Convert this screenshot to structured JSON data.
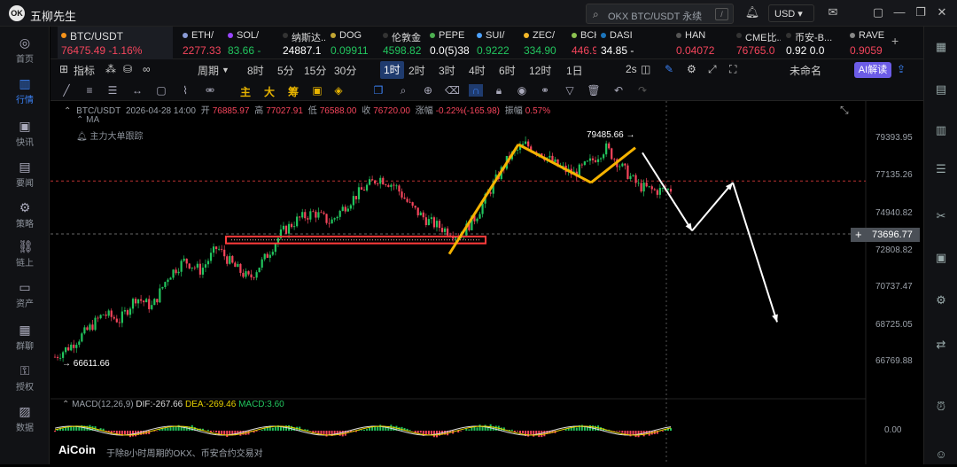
{
  "titlebar": {
    "app_title": "五柳先生",
    "logo": "OK",
    "search_placeholder": "OKX BTC/USDT 永续",
    "search_kbd": "/",
    "currency": "USD ▾"
  },
  "sidebar": {
    "items": [
      {
        "label": "首页",
        "icon": "home-icon",
        "glyph": "◎"
      },
      {
        "label": "行情",
        "icon": "chart-bars-icon",
        "glyph": "▥"
      },
      {
        "label": "快讯",
        "icon": "news-icon",
        "glyph": "▣"
      },
      {
        "label": "要闻",
        "icon": "document-icon",
        "glyph": "▤"
      },
      {
        "label": "策略",
        "icon": "strategy-icon",
        "glyph": "⚙"
      },
      {
        "label": "链上",
        "icon": "chain-icon",
        "glyph": "⛓"
      },
      {
        "label": "资产",
        "icon": "wallet-icon",
        "glyph": "▭"
      },
      {
        "label": "群聊",
        "icon": "chat-icon",
        "glyph": "▦"
      },
      {
        "label": "授权",
        "icon": "key-icon",
        "glyph": "⚿"
      },
      {
        "label": "数据",
        "icon": "data-icon",
        "glyph": "▨"
      }
    ]
  },
  "tickers": [
    {
      "name": "BTC/USDT",
      "price": "76475.49",
      "change": "-1.16%",
      "color": "#f5455c",
      "dot": "#f7931a"
    },
    {
      "name": "ETH/",
      "price": "2277.33",
      "change": "",
      "color": "#f5455c",
      "dot": "#8a9bd6"
    },
    {
      "name": "SOL/",
      "price": "83.66",
      "change": "-",
      "color": "#22c55e",
      "dot": "#9945ff"
    },
    {
      "name": "纳斯达...",
      "price": "24887.1",
      "change": "",
      "color": "#ffffff",
      "dot": "#333"
    },
    {
      "name": "DOG",
      "price": "0.09911",
      "change": "",
      "color": "#22c55e",
      "dot": "#c2a633"
    },
    {
      "name": "伦敦金",
      "price": "4598.82",
      "change": "",
      "color": "#22c55e",
      "dot": "#333"
    },
    {
      "name": "PEPE",
      "price": "0.0(5)38",
      "change": "",
      "color": "#ffffff",
      "dot": "#4caf50"
    },
    {
      "name": "SUI/",
      "price": "0.9222",
      "change": "",
      "color": "#22c55e",
      "dot": "#4da2ff"
    },
    {
      "name": "ZEC/",
      "price": "334.90",
      "change": "",
      "color": "#22c55e",
      "dot": "#f4b728"
    },
    {
      "name": "BCH",
      "price": "446.9",
      "change": "-",
      "color": "#f5455c",
      "dot": "#8dc351"
    },
    {
      "name": "DASI",
      "price": "34.85",
      "change": "-",
      "color": "#ffffff",
      "dot": "#1c75bc"
    },
    {
      "name": "HAN",
      "price": "0.04072",
      "change": "",
      "color": "#f5455c",
      "dot": "#555"
    },
    {
      "name": "CME比...",
      "price": "76765.0",
      "change": "",
      "color": "#f5455c",
      "dot": "#333"
    },
    {
      "name": "币安-B...",
      "price": "0.92",
      "change": "0.0",
      "color": "#ffffff",
      "dot": "#333"
    },
    {
      "name": "RAVE",
      "price": "0.9059",
      "change": "",
      "color": "#f5455c",
      "dot": "#888"
    }
  ],
  "toolbar": {
    "indicator": "指标",
    "period": "周期",
    "intervals": [
      "8时",
      "5分",
      "15分",
      "30分",
      "1时",
      "2时",
      "3时",
      "4时",
      "6时",
      "12时",
      "1日"
    ],
    "selected_interval": "1时",
    "secs": "2s",
    "unnamed": "未命名",
    "ai": "AI解读"
  },
  "drawtools": {
    "zhu": "主",
    "da": "大",
    "chou": "筹"
  },
  "info": {
    "symbol": "BTC/USDT",
    "datetime": "2026-04-28 14:00",
    "open_label": "开",
    "open": "76885.97",
    "high_label": "高",
    "high": "77027.91",
    "low_label": "低",
    "low": "76588.00",
    "close_label": "收",
    "close": "76720.00",
    "chg_label": "涨幅",
    "chg": "-0.22%(-165.98)",
    "amp_label": "振幅",
    "amp": "0.57%",
    "ma": "MA",
    "tracker": "主力大单跟踪"
  },
  "price_axis": [
    "79393.95",
    "77135.26",
    "74940.82",
    "72808.82",
    "70737.47",
    "68725.05",
    "66769.88",
    "0.00"
  ],
  "current_price": "73696.77",
  "annotations": {
    "high": "79485.66",
    "low": "66611.66"
  },
  "macd": {
    "label": "MACD(12,26,9)",
    "dif": "DIF:-267.66",
    "dea": "DEA:-269.46",
    "macd": "MACD:3.60"
  },
  "footer": {
    "brand": "AiCoin",
    "note": "于除8小时周期的OKX、币安合约交易对"
  },
  "chart_data": {
    "type": "candlestick",
    "symbol": "BTC/USDT",
    "interval": "1h",
    "ylim": [
      66000,
      80200
    ],
    "close_path": [
      66600,
      67300,
      68200,
      69200,
      68800,
      70200,
      69600,
      71500,
      72400,
      71800,
      73200,
      72100,
      71300,
      72600,
      74100,
      74900,
      75300,
      74700,
      75800,
      76700,
      77400,
      76900,
      75600,
      74800,
      74300,
      73900,
      75100,
      76900,
      78600,
      79400,
      78900,
      78100,
      77600,
      78300,
      79200,
      78000,
      76900,
      76600,
      76700
    ],
    "support_zone": [
      73600,
      73800
    ],
    "resistance_line": 77200,
    "hi": 79485.66,
    "lo": 66611.66,
    "projection": [
      76720,
      74200,
      77100,
      68700
    ]
  },
  "colors": {
    "up": "#22c55e",
    "down": "#f5455c",
    "accent": "#3b82f6",
    "orange": "#f5b300"
  }
}
